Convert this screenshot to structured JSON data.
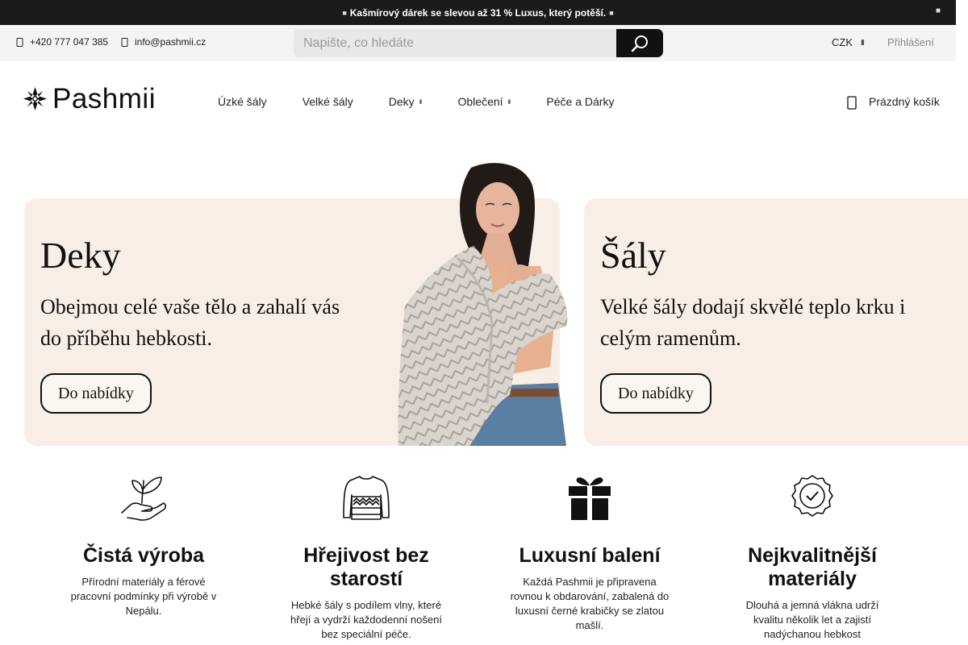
{
  "promo": {
    "text": "Kašmírový dárek se slevou až 31 % Luxus, který potěší."
  },
  "topbar": {
    "phone": "+420 777 047 385",
    "email": "info@pashmii.cz",
    "search_placeholder": "Napište, co hledáte",
    "currency": "CZK",
    "login": "Přihlášení"
  },
  "header": {
    "logo_text": "Pashmii",
    "nav": [
      {
        "label": "Úzké šály"
      },
      {
        "label": "Velké šály"
      },
      {
        "label": "Deky"
      },
      {
        "label": "Oblečení"
      },
      {
        "label": "Péče a Dárky"
      }
    ],
    "cart_label": "Prázdný košík"
  },
  "hero": {
    "cards": [
      {
        "title": "Deky",
        "text": "Obejmou celé vaše tělo a zahalí vás do příběhu hebkosti.",
        "button": "Do nabídky"
      },
      {
        "title": "Šály",
        "text": "Velké šály dodají skvělé teplo krku i celým ramenům.",
        "button": "Do nabídky"
      }
    ]
  },
  "features": [
    {
      "icon": "hand-plant-icon",
      "title": "Čistá výroba",
      "text": "Přírodní materiály a férové pracovní podmínky při výrobě v Nepálu."
    },
    {
      "icon": "sweater-icon",
      "title": "Hřejivost bez starostí",
      "text": "Hebké šály s podílem vlny, které hřejí a vydrží každodenní nošení bez speciální péče."
    },
    {
      "icon": "gift-icon",
      "title": "Luxusní balení",
      "text": "Každá Pashmii je připravena rovnou k obdarování, zabalená do luxusní černé krabičky se zlatou mašlí."
    },
    {
      "icon": "quality-badge-icon",
      "title": "Nejkvalitnější materiály",
      "text": "Dlouhá a jemná vlákna udrží kvalitu několik let a zajistí nadýchanou hebkost"
    }
  ],
  "colors": {
    "promo_bg": "#1b1b1b",
    "topbar_bg": "#f4f4f4",
    "card_bg": "#f8eee5",
    "search_button": "#111111"
  }
}
